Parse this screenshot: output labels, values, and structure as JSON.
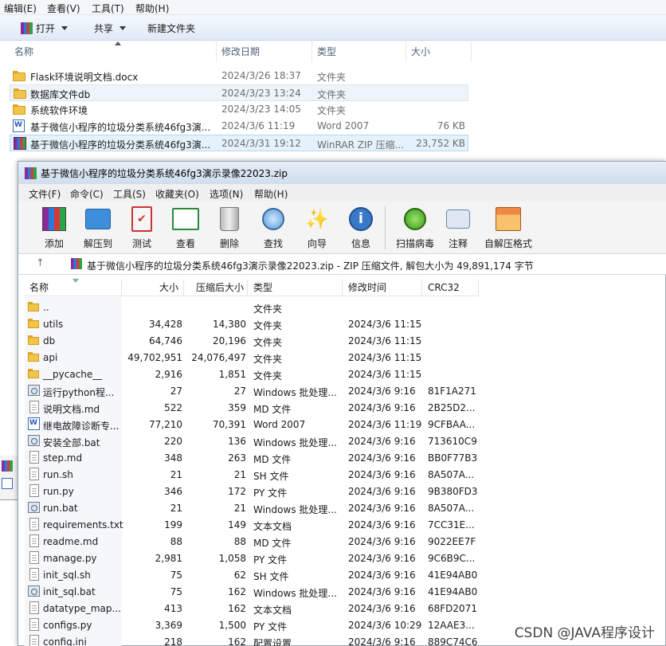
{
  "explorer": {
    "menu": [
      "编辑(E)",
      "查看(V)",
      "工具(T)",
      "帮助(H)"
    ],
    "toolbar": {
      "open": "打开",
      "share": "共享",
      "new_folder": "新建文件夹"
    },
    "columns": {
      "name": "名称",
      "date": "修改日期",
      "type": "类型",
      "size": "大小"
    },
    "rows": [
      {
        "name": "Flask环境说明文档.docx",
        "date": "2024/3/26 18:37",
        "type": "文件夹",
        "size": "",
        "icon": "folder-icon"
      },
      {
        "name": "数据库文件db",
        "date": "2024/3/23 13:24",
        "type": "文件夹",
        "size": "",
        "icon": "folder-icon"
      },
      {
        "name": "系统软件环境",
        "date": "2024/3/23 14:05",
        "type": "文件夹",
        "size": "",
        "icon": "folder-icon"
      },
      {
        "name": "基于微信小程序的垃圾分类系统46fg3演...",
        "date": "2024/3/6 11:19",
        "type": "Word 2007",
        "size": "76 KB",
        "icon": "word-document-icon"
      },
      {
        "name": "基于微信小程序的垃圾分类系统46fg3演...",
        "date": "2024/3/31 19:12",
        "type": "WinRAR ZIP 压缩...",
        "size": "23,752 KB",
        "icon": "winrar-archive-icon"
      }
    ]
  },
  "winrar": {
    "title": "基于微信小程序的垃圾分类系统46fg3演示录像22023.zip",
    "menu": [
      "文件(F)",
      "命令(C)",
      "工具(S)",
      "收藏夹(O)",
      "选项(N)",
      "帮助(H)"
    ],
    "toolbar": [
      "添加",
      "解压到",
      "测试",
      "查看",
      "删除",
      "查找",
      "向导",
      "信息",
      "扫描病毒",
      "注释",
      "自解压格式"
    ],
    "address": "基于微信小程序的垃圾分类系统46fg3演示录像22023.zip - ZIP 压缩文件, 解包大小为 49,891,174 字节",
    "columns": {
      "name": "名称",
      "size": "大小",
      "packed": "压缩后大小",
      "type": "类型",
      "modified": "修改时间",
      "crc": "CRC32"
    },
    "rows": [
      {
        "name": "..",
        "size": "",
        "packed": "",
        "type": "文件夹",
        "date": "",
        "crc": "",
        "icon": "folder"
      },
      {
        "name": "utils",
        "size": "34,428",
        "packed": "14,380",
        "type": "文件夹",
        "date": "2024/3/6 11:15",
        "crc": "",
        "icon": "folder"
      },
      {
        "name": "db",
        "size": "64,746",
        "packed": "20,196",
        "type": "文件夹",
        "date": "2024/3/6 11:15",
        "crc": "",
        "icon": "folder"
      },
      {
        "name": "api",
        "size": "49,702,951",
        "packed": "24,076,497",
        "type": "文件夹",
        "date": "2024/3/6 11:15",
        "crc": "",
        "icon": "folder"
      },
      {
        "name": "__pycache__",
        "size": "2,916",
        "packed": "1,851",
        "type": "文件夹",
        "date": "2024/3/6 11:15",
        "crc": "",
        "icon": "folder"
      },
      {
        "name": "运行python程...",
        "size": "27",
        "packed": "27",
        "type": "Windows 批处理...",
        "date": "2024/3/6 9:16",
        "crc": "81F1A271",
        "icon": "bat"
      },
      {
        "name": "说明文档.md",
        "size": "522",
        "packed": "359",
        "type": "MD 文件",
        "date": "2024/3/6 9:16",
        "crc": "2B25D2...",
        "icon": "file"
      },
      {
        "name": "继电故障诊断专...",
        "size": "77,210",
        "packed": "70,391",
        "type": "Word 2007",
        "date": "2024/3/6 11:19",
        "crc": "9CFBAA...",
        "icon": "word"
      },
      {
        "name": "安装全部.bat",
        "size": "220",
        "packed": "136",
        "type": "Windows 批处理...",
        "date": "2024/3/6 9:16",
        "crc": "713610C9",
        "icon": "bat"
      },
      {
        "name": "step.md",
        "size": "348",
        "packed": "263",
        "type": "MD 文件",
        "date": "2024/3/6 9:16",
        "crc": "BB0F77B3",
        "icon": "file"
      },
      {
        "name": "run.sh",
        "size": "21",
        "packed": "21",
        "type": "SH 文件",
        "date": "2024/3/6 9:16",
        "crc": "8A507A...",
        "icon": "file"
      },
      {
        "name": "run.py",
        "size": "346",
        "packed": "172",
        "type": "PY 文件",
        "date": "2024/3/6 9:16",
        "crc": "9B380FD3",
        "icon": "file"
      },
      {
        "name": "run.bat",
        "size": "21",
        "packed": "21",
        "type": "Windows 批处理...",
        "date": "2024/3/6 9:16",
        "crc": "8A507A...",
        "icon": "bat"
      },
      {
        "name": "requirements.txt",
        "size": "199",
        "packed": "149",
        "type": "文本文档",
        "date": "2024/3/6 9:16",
        "crc": "7CC31E...",
        "icon": "file"
      },
      {
        "name": "readme.md",
        "size": "88",
        "packed": "88",
        "type": "MD 文件",
        "date": "2024/3/6 9:16",
        "crc": "9022EE7F",
        "icon": "file"
      },
      {
        "name": "manage.py",
        "size": "2,981",
        "packed": "1,058",
        "type": "PY 文件",
        "date": "2024/3/6 9:16",
        "crc": "9C6B9C...",
        "icon": "file"
      },
      {
        "name": "init_sql.sh",
        "size": "75",
        "packed": "62",
        "type": "SH 文件",
        "date": "2024/3/6 9:16",
        "crc": "41E94AB0",
        "icon": "file"
      },
      {
        "name": "init_sql.bat",
        "size": "75",
        "packed": "162",
        "type": "Windows 批处理...",
        "date": "2024/3/6 9:16",
        "crc": "41E94AB0",
        "icon": "bat"
      },
      {
        "name": "datatype_map...",
        "size": "413",
        "packed": "162",
        "type": "文本文档",
        "date": "2024/3/6 9:16",
        "crc": "68FD2071",
        "icon": "file"
      },
      {
        "name": "configs.py",
        "size": "3,369",
        "packed": "1,500",
        "type": "PY 文件",
        "date": "2024/3/6 10:29",
        "crc": "12AAE3...",
        "icon": "file"
      },
      {
        "name": "config.ini",
        "size": "218",
        "packed": "162",
        "type": "配置设置",
        "date": "2024/3/6 9:16",
        "crc": "889C74C6",
        "icon": "file"
      }
    ]
  },
  "watermark": "CSDN @JAVA程序设计"
}
